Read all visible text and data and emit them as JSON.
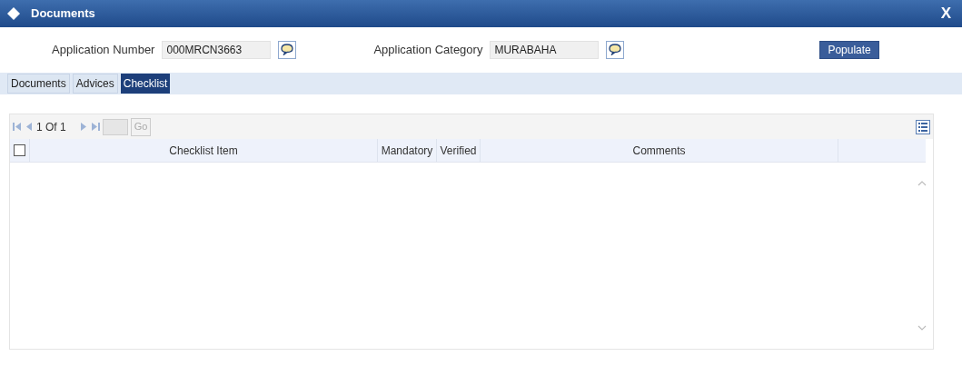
{
  "window": {
    "title": "Documents",
    "close": "X"
  },
  "fields": [
    {
      "label": "Application Number",
      "value": "000MRCN3663"
    },
    {
      "label": "Application Category",
      "value": "MURABAHA"
    }
  ],
  "populate_button": "Populate",
  "tabs": [
    {
      "label": "Documents",
      "selected": false
    },
    {
      "label": "Advices",
      "selected": false
    },
    {
      "label": "Checklist",
      "selected": true
    }
  ],
  "pager": {
    "page": "1 Of 1",
    "go": "Go"
  },
  "table": {
    "select_all": {
      "checked": false
    },
    "columns": [
      "Checklist Item",
      "Mandatory",
      "Verified",
      "Comments"
    ]
  }
}
